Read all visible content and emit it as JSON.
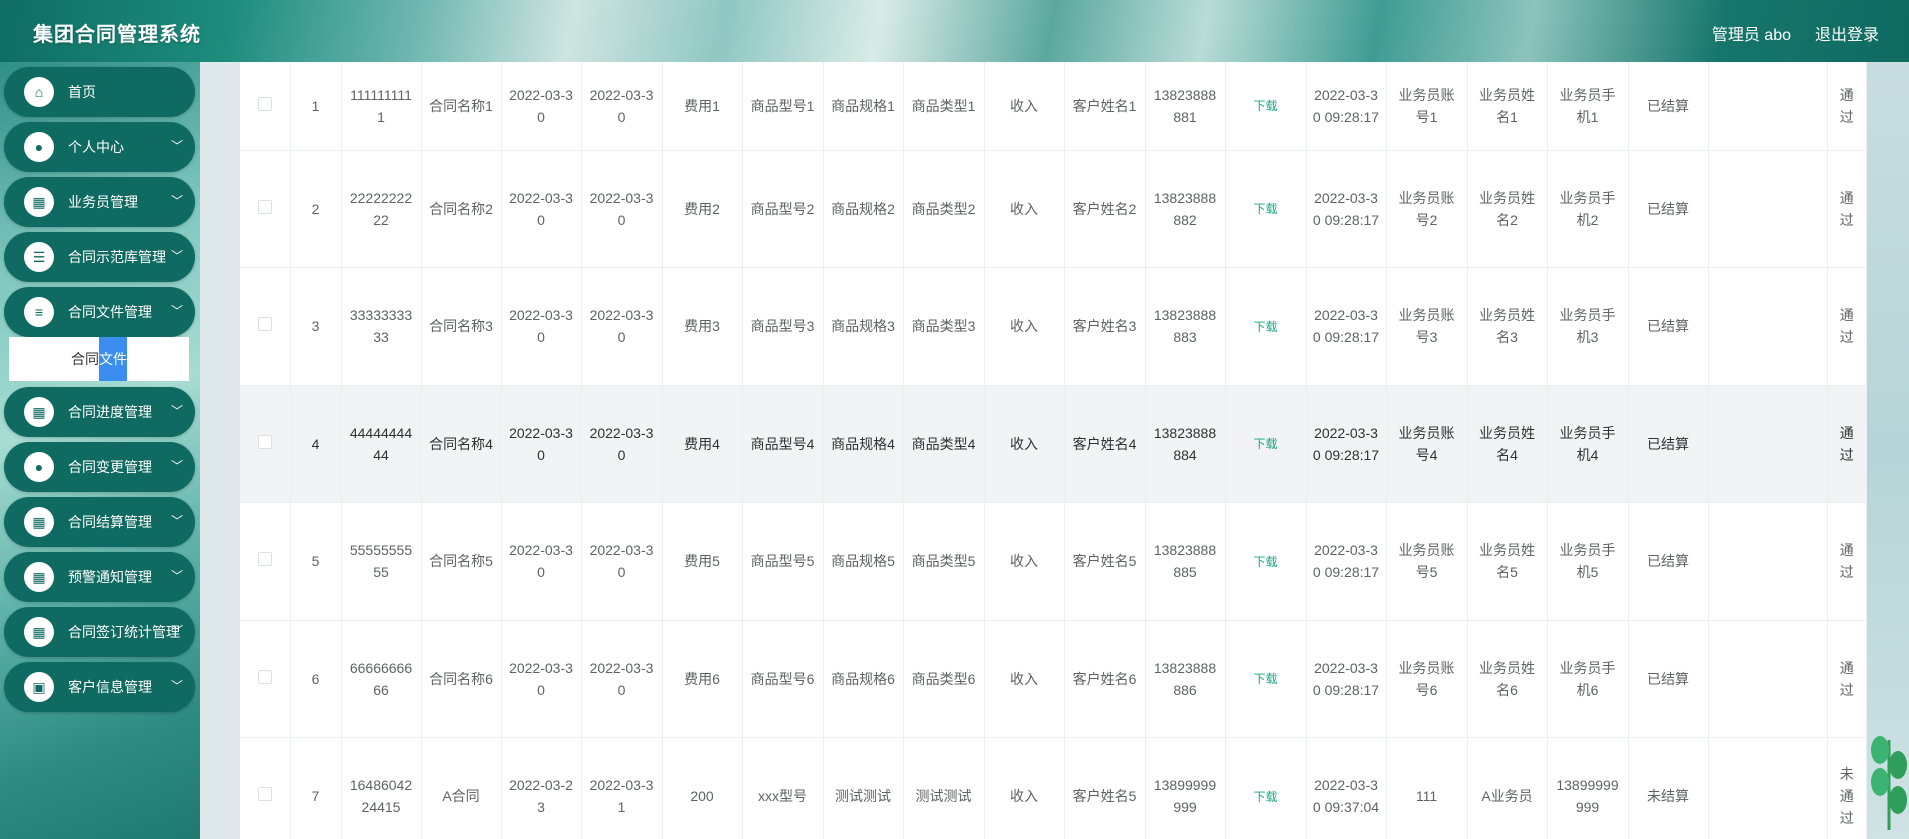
{
  "header": {
    "title": "集团合同管理系统",
    "admin_label": "管理员 abo",
    "logout_label": "退出登录"
  },
  "sidebar": {
    "items": [
      {
        "label": "首页",
        "icon": "home-icon",
        "glyph": "⌂",
        "chevron": false
      },
      {
        "label": "个人中心",
        "icon": "user-icon",
        "glyph": "●",
        "chevron": true
      },
      {
        "label": "业务员管理",
        "icon": "grid-icon",
        "glyph": "▦",
        "chevron": true
      },
      {
        "label": "合同示范库管理",
        "icon": "list-icon",
        "glyph": "☰",
        "chevron": true
      },
      {
        "label": "合同文件管理",
        "icon": "document-icon",
        "glyph": "≡",
        "chevron": true
      },
      {
        "label": "合同进度管理",
        "icon": "grid-icon",
        "glyph": "▦",
        "chevron": true
      },
      {
        "label": "合同变更管理",
        "icon": "pin-icon",
        "glyph": "●",
        "chevron": true
      },
      {
        "label": "合同结算管理",
        "icon": "grid-icon",
        "glyph": "▦",
        "chevron": true
      },
      {
        "label": "预警通知管理",
        "icon": "grid-icon",
        "glyph": "▦",
        "chevron": true
      },
      {
        "label": "合同签订统计管理",
        "icon": "grid-icon",
        "glyph": "▦",
        "chevron": true
      },
      {
        "label": "客户信息管理",
        "icon": "briefcase-icon",
        "glyph": "▣",
        "chevron": true
      }
    ],
    "submenu": {
      "prefix": "合同",
      "highlight": "文件"
    },
    "chevron_glyph": "﹀"
  },
  "table": {
    "download_label": "下载",
    "rows": [
      [
        "1",
        "1111111111",
        "合同名称1",
        "2022-03-30",
        "2022-03-30",
        "费用1",
        "商品型号1",
        "商品规格1",
        "商品类型1",
        "收入",
        "客户姓名1",
        "13823888881",
        "2022-03-30 09:28:17",
        "业务员账号1",
        "业务员姓名1",
        "业务员手机1",
        "已结算",
        "",
        "通过"
      ],
      [
        "2",
        "2222222222",
        "合同名称2",
        "2022-03-30",
        "2022-03-30",
        "费用2",
        "商品型号2",
        "商品规格2",
        "商品类型2",
        "收入",
        "客户姓名2",
        "13823888882",
        "2022-03-30 09:28:17",
        "业务员账号2",
        "业务员姓名2",
        "业务员手机2",
        "已结算",
        "",
        "通过"
      ],
      [
        "3",
        "3333333333",
        "合同名称3",
        "2022-03-30",
        "2022-03-30",
        "费用3",
        "商品型号3",
        "商品规格3",
        "商品类型3",
        "收入",
        "客户姓名3",
        "13823888883",
        "2022-03-30 09:28:17",
        "业务员账号3",
        "业务员姓名3",
        "业务员手机3",
        "已结算",
        "",
        "通过"
      ],
      [
        "4",
        "4444444444",
        "合同名称4",
        "2022-03-30",
        "2022-03-30",
        "费用4",
        "商品型号4",
        "商品规格4",
        "商品类型4",
        "收入",
        "客户姓名4",
        "13823888884",
        "2022-03-30 09:28:17",
        "业务员账号4",
        "业务员姓名4",
        "业务员手机4",
        "已结算",
        "",
        "通过"
      ],
      [
        "5",
        "5555555555",
        "合同名称5",
        "2022-03-30",
        "2022-03-30",
        "费用5",
        "商品型号5",
        "商品规格5",
        "商品类型5",
        "收入",
        "客户姓名5",
        "13823888885",
        "2022-03-30 09:28:17",
        "业务员账号5",
        "业务员姓名5",
        "业务员手机5",
        "已结算",
        "",
        "通过"
      ],
      [
        "6",
        "6666666666",
        "合同名称6",
        "2022-03-30",
        "2022-03-30",
        "费用6",
        "商品型号6",
        "商品规格6",
        "商品类型6",
        "收入",
        "客户姓名6",
        "13823888886",
        "2022-03-30 09:28:17",
        "业务员账号6",
        "业务员姓名6",
        "业务员手机6",
        "已结算",
        "",
        "通过"
      ],
      [
        "7",
        "1648604224415",
        "A合同",
        "2022-03-23",
        "2022-03-31",
        "200",
        "xxx型号",
        "测试测试",
        "测试测试",
        "收入",
        "客户姓名5",
        "13899999999",
        "2022-03-30 09:37:04",
        "111",
        "A业务员",
        "13899999999",
        "未结算",
        "",
        "未通过"
      ]
    ]
  }
}
